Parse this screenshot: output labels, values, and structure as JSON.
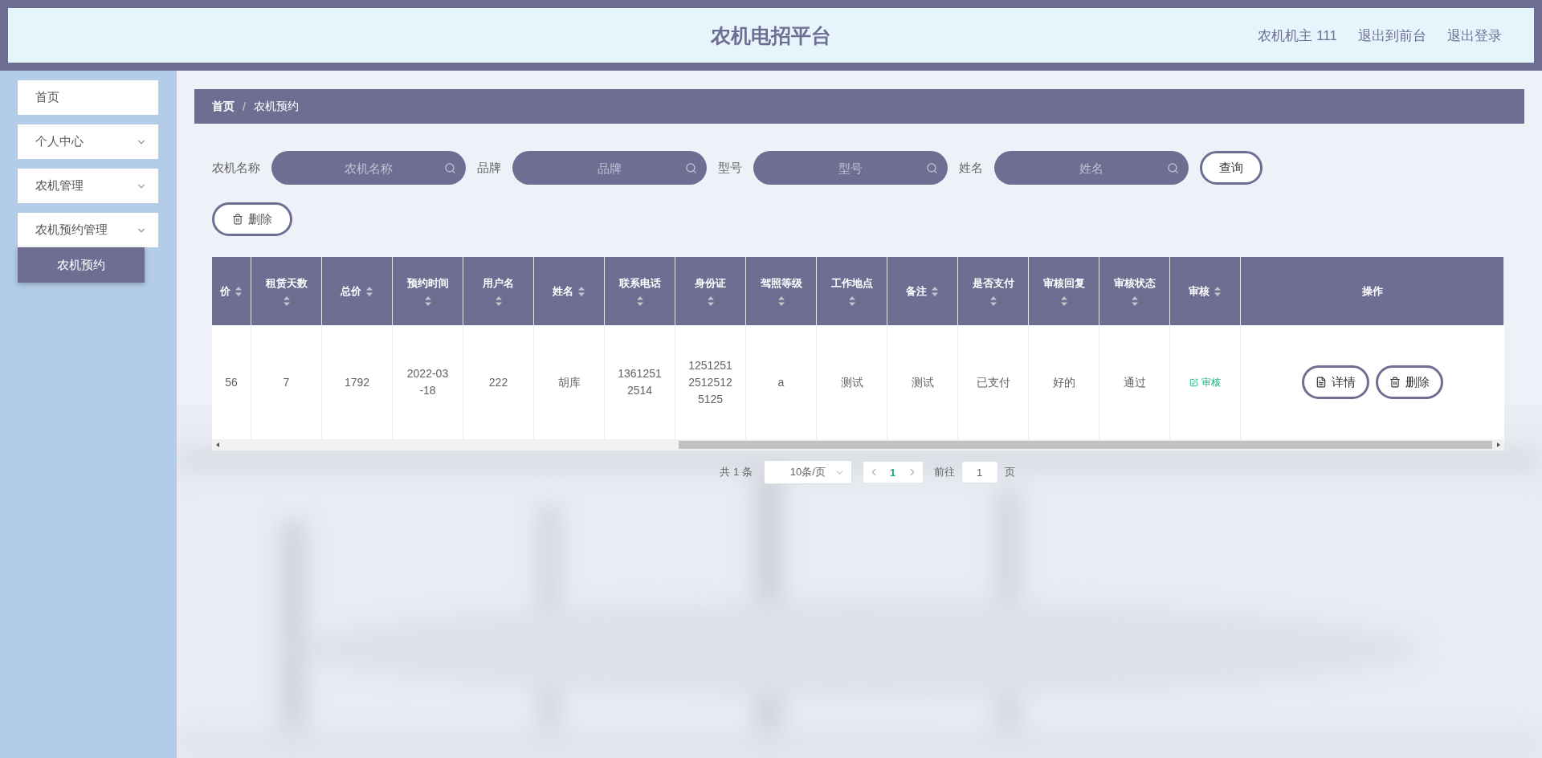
{
  "header": {
    "title": "农机电招平台",
    "user": "农机机主 111",
    "links": [
      "退出到前台",
      "退出登录"
    ]
  },
  "sidebar": {
    "items": [
      {
        "label": "首页",
        "kind": "link",
        "selected": false
      },
      {
        "label": "个人中心",
        "kind": "submenu",
        "selected": false
      },
      {
        "label": "农机管理",
        "kind": "submenu",
        "selected": false
      },
      {
        "label": "农机预约管理",
        "kind": "submenu",
        "selected": false,
        "children": [
          {
            "label": "农机预约",
            "selected": true
          }
        ]
      }
    ]
  },
  "breadcrumb": {
    "items": [
      "首页",
      "农机预约"
    ],
    "separator": "/"
  },
  "search": {
    "fields": [
      {
        "label": "农机名称",
        "placeholder": "农机名称"
      },
      {
        "label": "品牌",
        "placeholder": "品牌"
      },
      {
        "label": "型号",
        "placeholder": "型号"
      },
      {
        "label": "姓名",
        "placeholder": "姓名"
      }
    ],
    "query_button": "查询"
  },
  "toolbar": {
    "delete_button": "删除"
  },
  "table": {
    "columns": [
      {
        "label": "价",
        "sortable": true
      },
      {
        "label": "租赁天数",
        "sortable": true
      },
      {
        "label": "总价",
        "sortable": true
      },
      {
        "label": "预约时间",
        "sortable": true
      },
      {
        "label": "用户名",
        "sortable": true
      },
      {
        "label": "姓名",
        "sortable": true
      },
      {
        "label": "联系电话",
        "sortable": true
      },
      {
        "label": "身份证",
        "sortable": true
      },
      {
        "label": "驾照等级",
        "sortable": true
      },
      {
        "label": "工作地点",
        "sortable": true
      },
      {
        "label": "备注",
        "sortable": true
      },
      {
        "label": "是否支付",
        "sortable": true
      },
      {
        "label": "审核回复",
        "sortable": true
      },
      {
        "label": "审核状态",
        "sortable": true
      },
      {
        "label": "审核",
        "sortable": true
      },
      {
        "label": "操作",
        "sortable": false
      }
    ],
    "rows": [
      {
        "cells": [
          "56",
          "7",
          "1792",
          "2022-03-18",
          "222",
          "胡库",
          "13612512514",
          "125125125125125125",
          "a",
          "测试",
          "测试",
          "已支付",
          "好的",
          "通过"
        ],
        "review_link": "审核",
        "actions": [
          {
            "kind": "detail",
            "label": "详情"
          },
          {
            "kind": "delete",
            "label": "删除"
          }
        ]
      }
    ]
  },
  "pagination": {
    "total": "共 1 条",
    "page_size": "10条/页",
    "pages": [
      {
        "label": "1",
        "selected": true
      }
    ],
    "goto_label": "前往",
    "goto_value": "1",
    "page_unit": "页"
  }
}
